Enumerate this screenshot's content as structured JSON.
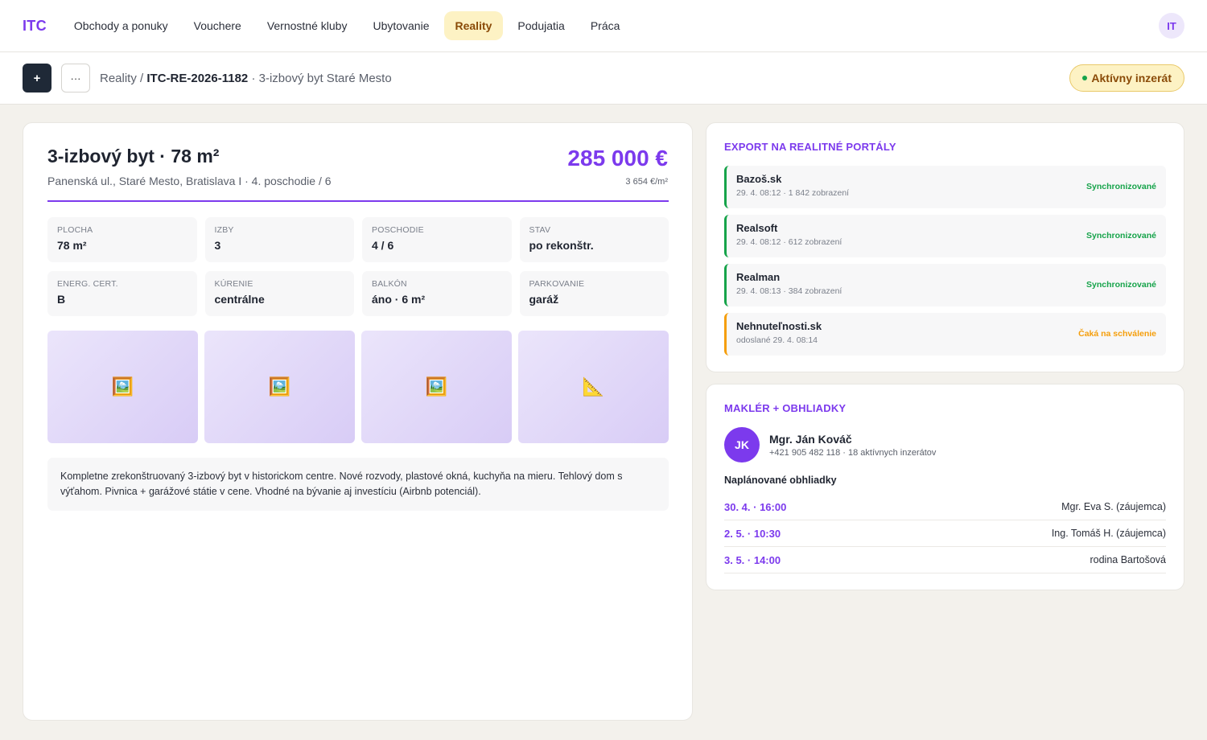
{
  "nav": {
    "logo": "ITC",
    "items": [
      {
        "label": "Obchody a ponuky",
        "active": false
      },
      {
        "label": "Vouchere",
        "active": false
      },
      {
        "label": "Vernostné kluby",
        "active": false
      },
      {
        "label": "Ubytovanie",
        "active": false
      },
      {
        "label": "Reality",
        "active": true
      },
      {
        "label": "Podujatia",
        "active": false
      },
      {
        "label": "Práca",
        "active": false
      }
    ],
    "avatar": "IT"
  },
  "subbar": {
    "add_label": "+",
    "more_label": "···",
    "crumb_root": "Reality",
    "crumb_sep": " / ",
    "crumb_id": "ITC-RE-2026-1182",
    "crumb_title": " · 3-izbový byt Staré Mesto",
    "status": "Aktívny inzerát"
  },
  "listing": {
    "title": "3-izbový byt · 78 m²",
    "address": "Panenská ul., Staré Mesto, Bratislava I · 4. poschodie / 6",
    "price": "285 000 €",
    "price_per_m2": "3 654 €/m²",
    "stats": [
      {
        "label": "PLOCHA",
        "value": "78 m²"
      },
      {
        "label": "IZBY",
        "value": "3"
      },
      {
        "label": "POSCHODIE",
        "value": "4 / 6"
      },
      {
        "label": "STAV",
        "value": "po rekonštr."
      },
      {
        "label": "ENERG. CERT.",
        "value": "B"
      },
      {
        "label": "KÚRENIE",
        "value": "centrálne"
      },
      {
        "label": "BALKÓN",
        "value": "áno · 6 m²"
      },
      {
        "label": "PARKOVANIE",
        "value": "garáž"
      }
    ],
    "photos": [
      {
        "icon": "picture-icon",
        "glyph": "🖼️"
      },
      {
        "icon": "picture-icon",
        "glyph": "🖼️"
      },
      {
        "icon": "picture-icon",
        "glyph": "🖼️"
      },
      {
        "icon": "floorplan-icon",
        "glyph": "📐"
      }
    ],
    "description": "Kompletne zrekonštruovaný 3-izbový byt v historickom centre. Nové rozvody, plastové okná, kuchyňa na mieru. Tehlový dom s výťahom. Pivnica + garážové státie v cene. Vhodné na bývanie aj investíciu (Airbnb potenciál)."
  },
  "export": {
    "heading": "EXPORT NA REALITNÉ PORTÁLY",
    "portals": [
      {
        "name": "Bazoš.sk",
        "meta": "29. 4. 08:12 · 1 842 zobrazení",
        "status": "Synchronizované",
        "state": "synced"
      },
      {
        "name": "Realsoft",
        "meta": "29. 4. 08:12 · 612 zobrazení",
        "status": "Synchronizované",
        "state": "synced"
      },
      {
        "name": "Realman",
        "meta": "29. 4. 08:13 · 384 zobrazení",
        "status": "Synchronizované",
        "state": "synced"
      },
      {
        "name": "Nehnuteľnosti.sk",
        "meta": "odoslané 29. 4. 08:14",
        "status": "Čaká na schválenie",
        "state": "pending"
      }
    ]
  },
  "broker": {
    "heading": "MAKLÉR + OBHLIADKY",
    "initials": "JK",
    "name": "Mgr. Ján Kováč",
    "meta": "+421 905 482 118 · 18 aktívnych inzerátov",
    "visits_heading": "Naplánované obhliadky",
    "visits": [
      {
        "time": "30. 4. · 16:00",
        "who": "Mgr. Eva S. (záujemca)"
      },
      {
        "time": "2. 5. · 10:30",
        "who": "Ing. Tomáš H. (záujemca)"
      },
      {
        "time": "3. 5. · 14:00",
        "who": "rodina Bartošová"
      }
    ]
  },
  "colors": {
    "accent": "#7c3aed",
    "active_nav_bg": "#fdf2c4",
    "synced": "#16a34a",
    "pending": "#f59e0b"
  }
}
